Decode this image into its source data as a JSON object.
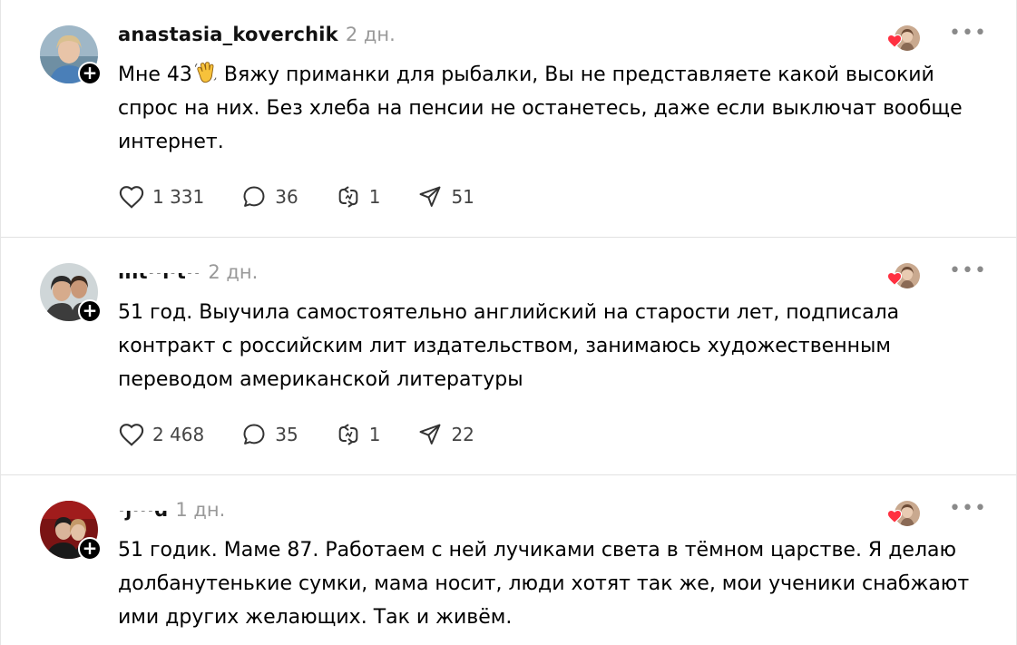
{
  "posts": [
    {
      "username": "anastasia_koverchik",
      "time": "2 дн.",
      "text_before_emoji": "Мне 43",
      "emoji": "waving-hand-emoji",
      "text_after_emoji": " Вяжу приманки для рыбалки, Вы не представляете какой высокий спрос на них. Без хлеба на пенсии не останетесь, даже если выключат вообще интернет.",
      "likes": "1 331",
      "replies": "36",
      "reposts": "1",
      "shares": "51"
    },
    {
      "username": "int··i·t··",
      "time": "2 дн.",
      "text": "51 год. Выучила самостоятельно английский на старости лет, подписала контракт с российским лит издательством, занимаюсь художественным переводом американской литературы",
      "likes": "2 468",
      "replies": "35",
      "reposts": "1",
      "shares": "22"
    },
    {
      "username": "·j···d",
      "time": "1 дн.",
      "text": "51 годик. Маме 87. Работаем с ней лучиками света в тёмном царстве. Я делаю долбанутенькие сумки, мама носит, люди хотят так же, мои ученики снабжают ими других желающих. Так и живём."
    }
  ],
  "more_label": "•••",
  "follow_label": "+",
  "colors": {
    "heart": "#ff3040",
    "meta_gray": "#999999",
    "icon_gray": "#444444"
  }
}
